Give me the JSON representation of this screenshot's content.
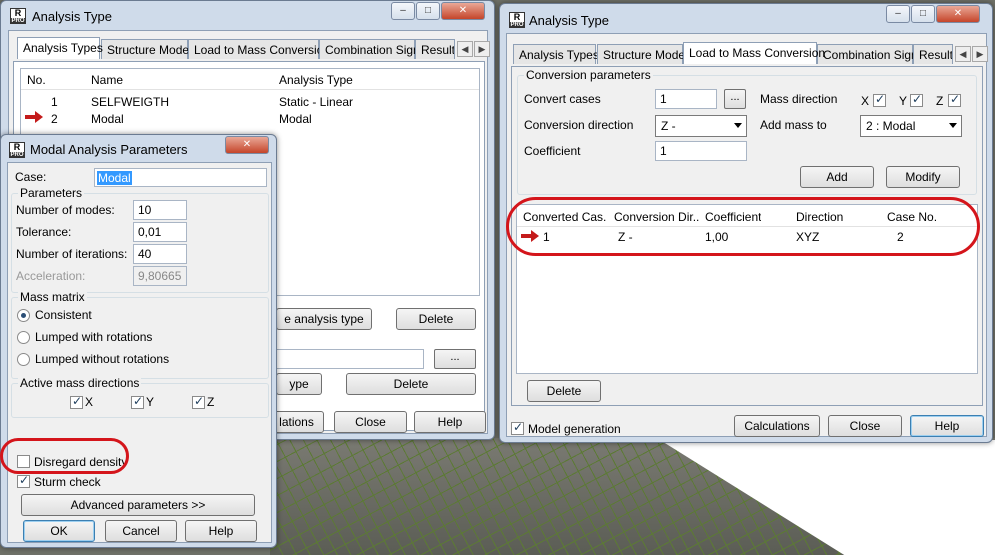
{
  "colors": {
    "accent_red": "#d4151b",
    "window_frame": "#cfdbea",
    "panel": "#f0f0f0"
  },
  "left_window": {
    "title": "Analysis Type",
    "tabs": [
      "Analysis Types",
      "Structure Model",
      "Load to Mass Conversion",
      "Combination Sign",
      "Result F"
    ],
    "table": {
      "headers": [
        "No.",
        "Name",
        "Analysis Type"
      ],
      "rows": [
        {
          "no": "1",
          "name": "SELFWEIGTH",
          "type": "Static - Linear"
        },
        {
          "no": "2",
          "name": "Modal",
          "type": "Modal"
        }
      ]
    },
    "buttons": {
      "change_type": "e analysis type",
      "delete1": "Delete",
      "browse": "...",
      "type": "ype",
      "delete2": "Delete",
      "calculations": "lations",
      "close": "Close",
      "help": "Help"
    }
  },
  "modal_dialog": {
    "title": "Modal Analysis Parameters",
    "case_label": "Case:",
    "case_value": "Modal",
    "parameters_title": "Parameters",
    "num_modes_label": "Number of modes:",
    "num_modes": "10",
    "tolerance_label": "Tolerance:",
    "tolerance": "0,01",
    "iterations_label": "Number of iterations:",
    "iterations": "40",
    "acceleration_label": "Acceleration:",
    "acceleration": "9,80665",
    "mass_matrix_title": "Mass matrix",
    "mass_options": [
      "Consistent",
      "Lumped with rotations",
      "Lumped without rotations"
    ],
    "active_mass_title": "Active mass directions",
    "directions": [
      "X",
      "Y",
      "Z"
    ],
    "disregard_density": "Disregard density",
    "sturm_check": "Sturm check",
    "advanced": "Advanced parameters >>",
    "ok": "OK",
    "cancel": "Cancel",
    "help": "Help"
  },
  "right_window": {
    "title": "Analysis Type",
    "tabs": [
      "Analysis Types",
      "Structure Model",
      "Load to Mass Conversion",
      "Combination Sign",
      "Result F"
    ],
    "group_title": "Conversion parameters",
    "convert_cases_label": "Convert cases",
    "convert_cases_value": "1",
    "browse": "...",
    "mass_direction_label": "Mass direction",
    "dir_x": "X",
    "dir_y": "Y",
    "dir_z": "Z",
    "conversion_direction_label": "Conversion direction",
    "conversion_direction_value": "Z -",
    "add_mass_to_label": "Add mass to",
    "add_mass_to_value": "2 : Modal",
    "coefficient_label": "Coefficient",
    "coefficient_value": "1",
    "add": "Add",
    "modify": "Modify",
    "table": {
      "headers": [
        "Converted Cas...",
        "Conversion Dir...",
        "Coefficient",
        "Direction",
        "Case No."
      ],
      "rows": [
        {
          "case": "1",
          "dir": "Z -",
          "coef": "1,00",
          "direction": "XYZ",
          "case_no": "2"
        }
      ]
    },
    "delete": "Delete",
    "model_generation": "Model generation",
    "calculations": "Calculations",
    "close": "Close",
    "help": "Help"
  }
}
